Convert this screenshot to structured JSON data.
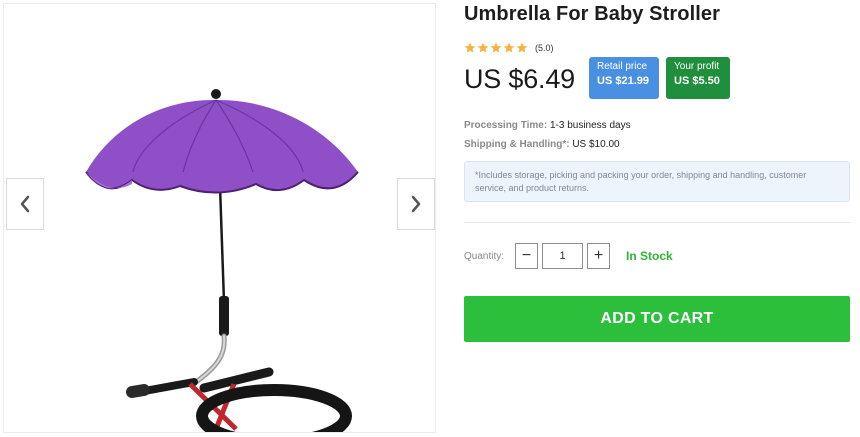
{
  "product": {
    "title": "Umbrella For Baby Stroller",
    "rating_text": "(5.0)",
    "rating_value": 5,
    "price": "US $6.49",
    "retail_label": "Retail price",
    "retail_value": "US $21.99",
    "profit_label": "Your profit",
    "profit_value": "US $5.50"
  },
  "details": {
    "processing_label": "Processing Time:",
    "processing_value": "1-3 business days",
    "shipping_label": "Shipping & Handling*:",
    "shipping_value": "US $10.00",
    "note": "*Includes storage, picking and packing your order, shipping and handling, customer service, and product returns."
  },
  "purchase": {
    "quantity_label": "Quantity:",
    "quantity_value": "1",
    "minus_symbol": "−",
    "plus_symbol": "+",
    "stock_status": "In Stock",
    "add_to_cart": "ADD TO CART"
  },
  "colors": {
    "star": "#f5b342",
    "retail_badge": "#4a90e2",
    "profit_badge": "#1f8e3d",
    "in_stock": "#2cb634",
    "cart_button": "#2bbf3b",
    "umbrella_canopy": "#8f4fc7"
  },
  "icons": {
    "prev": "chevron-left-icon",
    "next": "chevron-right-icon",
    "rating": "star-icon"
  }
}
